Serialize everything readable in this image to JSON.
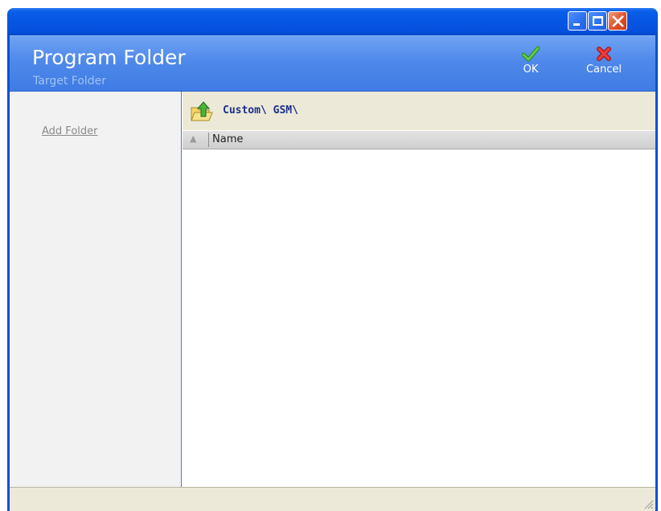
{
  "window": {
    "controls": [
      "minimize",
      "maximize",
      "close"
    ]
  },
  "header": {
    "title": "Program Folder",
    "subtitle": "Target Folder",
    "ok_label": "OK",
    "cancel_label": "Cancel"
  },
  "sidebar": {
    "add_folder_label": "Add Folder"
  },
  "browser": {
    "path": "Custom\\ GSM\\",
    "sort_indicator": "▲",
    "column_name": "Name",
    "items": []
  },
  "colors": {
    "titlebar": "#0656e3",
    "header": "#4f89ea",
    "ok_check": "#3aa63a",
    "cancel_x": "#e03030",
    "path_text": "#1a2f8a"
  }
}
